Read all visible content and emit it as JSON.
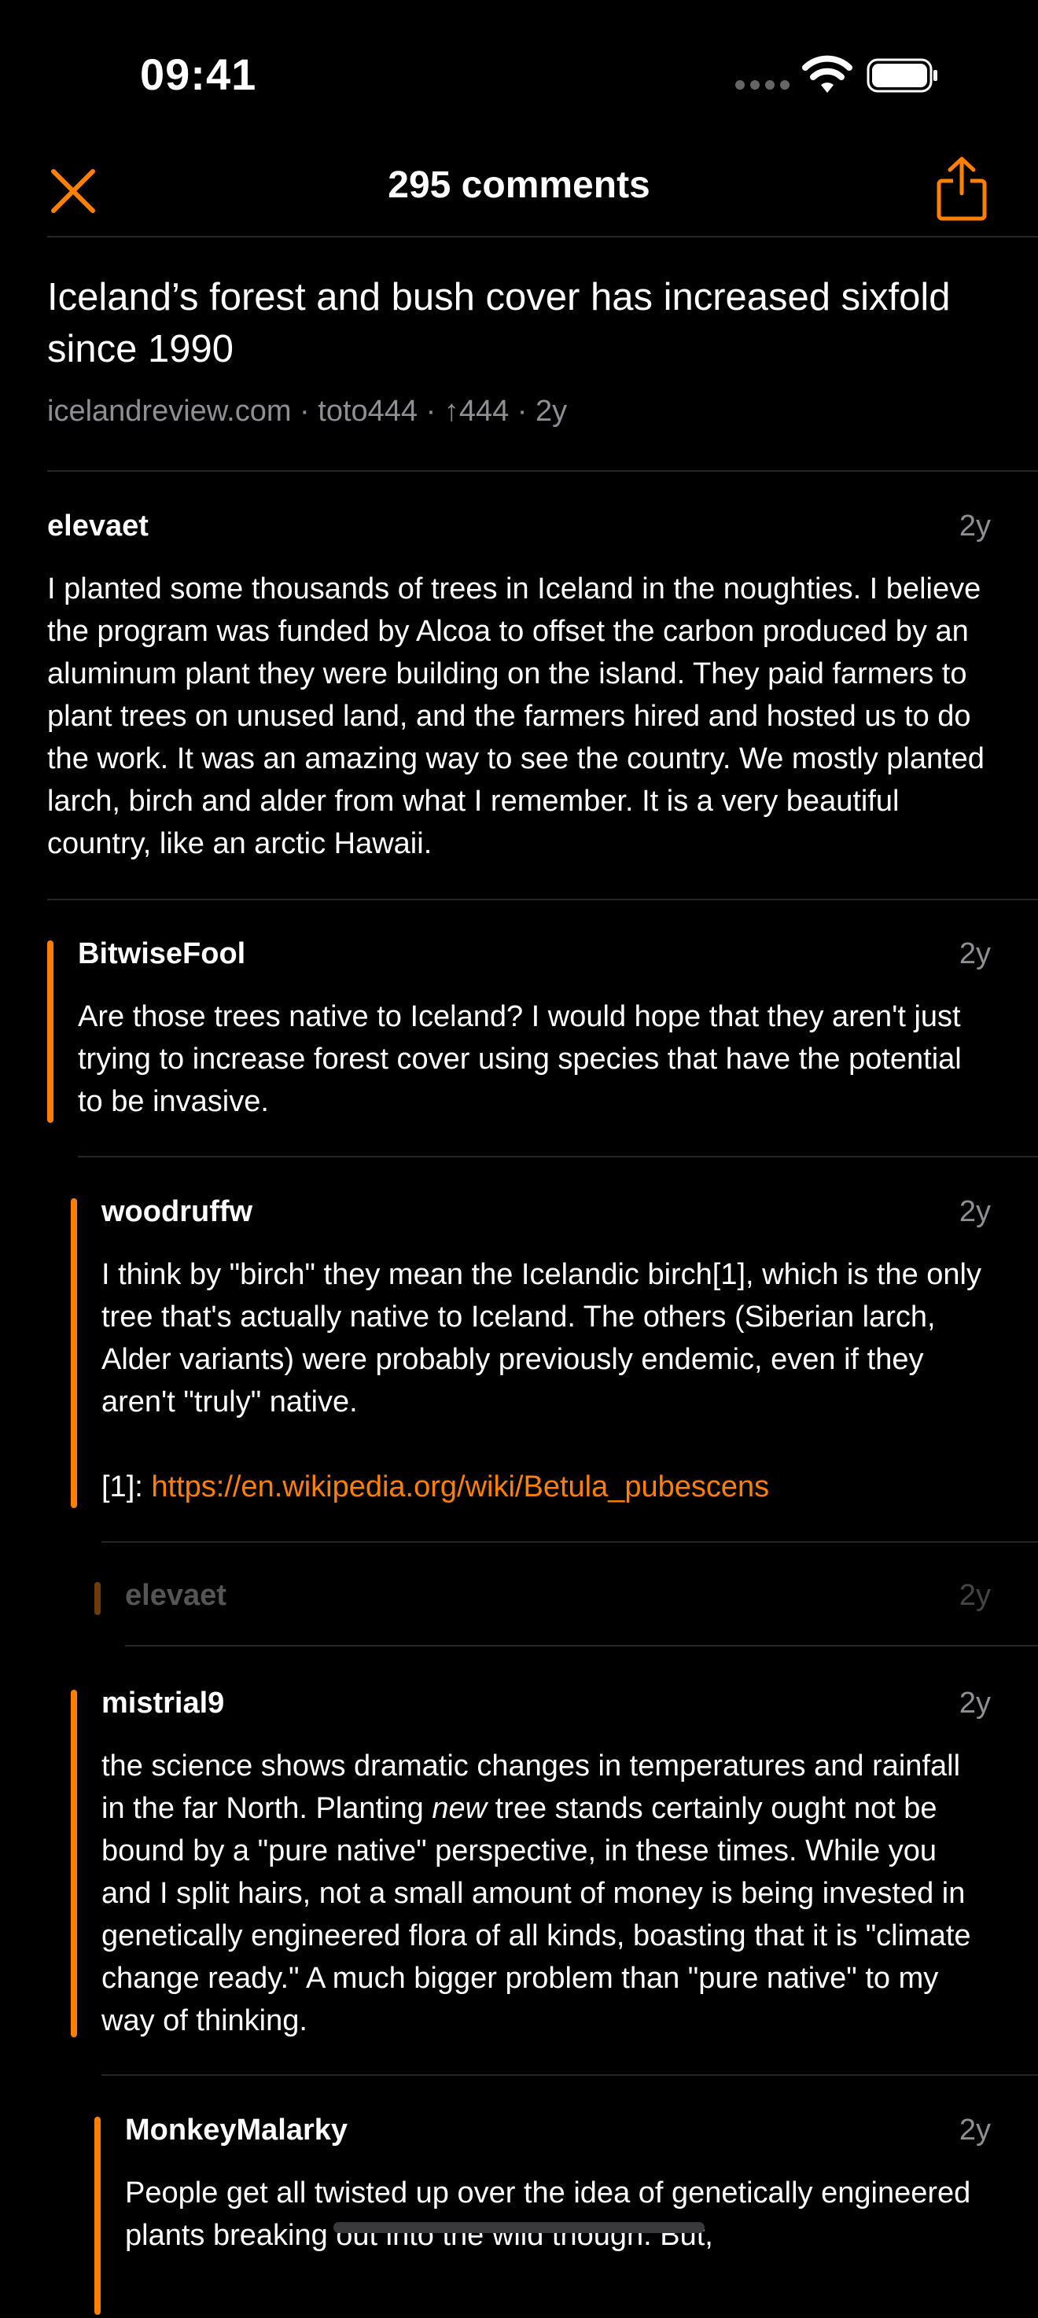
{
  "status_bar": {
    "time": "09:41"
  },
  "nav": {
    "title": "295 comments",
    "close_icon": "close-icon",
    "share_icon": "share-icon",
    "accent_color": "#ff7f00"
  },
  "story": {
    "title": "Iceland’s forest and bush cover has increased sixfold since 1990",
    "domain": "icelandreview.com",
    "author": "toto444",
    "points": "↑444",
    "age": "2y"
  },
  "comments": [
    {
      "author": "elevaet",
      "age": "2y",
      "body": "I planted some thousands of trees in Iceland in the noughties. I believe the program was funded by Alcoa to offset the carbon produced by an aluminum plant they were building on the island. They paid farmers to plant trees on unused land, and the farmers hired and hosted us to do the work. It was an amazing way to see the country. We mostly planted larch, birch and alder from what I remember. It is a very beautiful country, like an arctic Hawaii."
    },
    {
      "author": "BitwiseFool",
      "age": "2y",
      "body": "Are those trees native to Iceland? I would hope that they aren't just trying to increase forest cover using species that have the potential to be invasive."
    },
    {
      "author": "woodruffw",
      "age": "2y",
      "body": "I think by \"birch\" they mean the Icelandic birch[1], which is the only tree that's actually native to Iceland. The others (Siberian larch, Alder variants) were probably previously endemic, even if they aren't \"truly\" native.",
      "footnote_label": "[1]:",
      "footnote_link": "https://en.wikipedia.org/wiki/Betula_pubescens"
    },
    {
      "author": "elevaet",
      "age": "2y",
      "collapsed": true
    },
    {
      "author": "mistrial9",
      "age": "2y",
      "body_before": "the science shows dramatic changes in temperatures and rainfall in the far North. Planting ",
      "body_em": "new",
      "body_after": " tree stands certainly ought not be bound by a \"pure native\" perspective, in these times.  While you and I split hairs, not a small amount of money is being invested in genetically engineered flora of all kinds, boasting that it is \"climate change ready.\"  A much bigger problem than \"pure native\" to my way of thinking."
    },
    {
      "author": "MonkeyMalarky",
      "age": "2y",
      "body": "People get all twisted up over the idea of genetically engineered plants breaking out into the wild though. But,"
    }
  ]
}
